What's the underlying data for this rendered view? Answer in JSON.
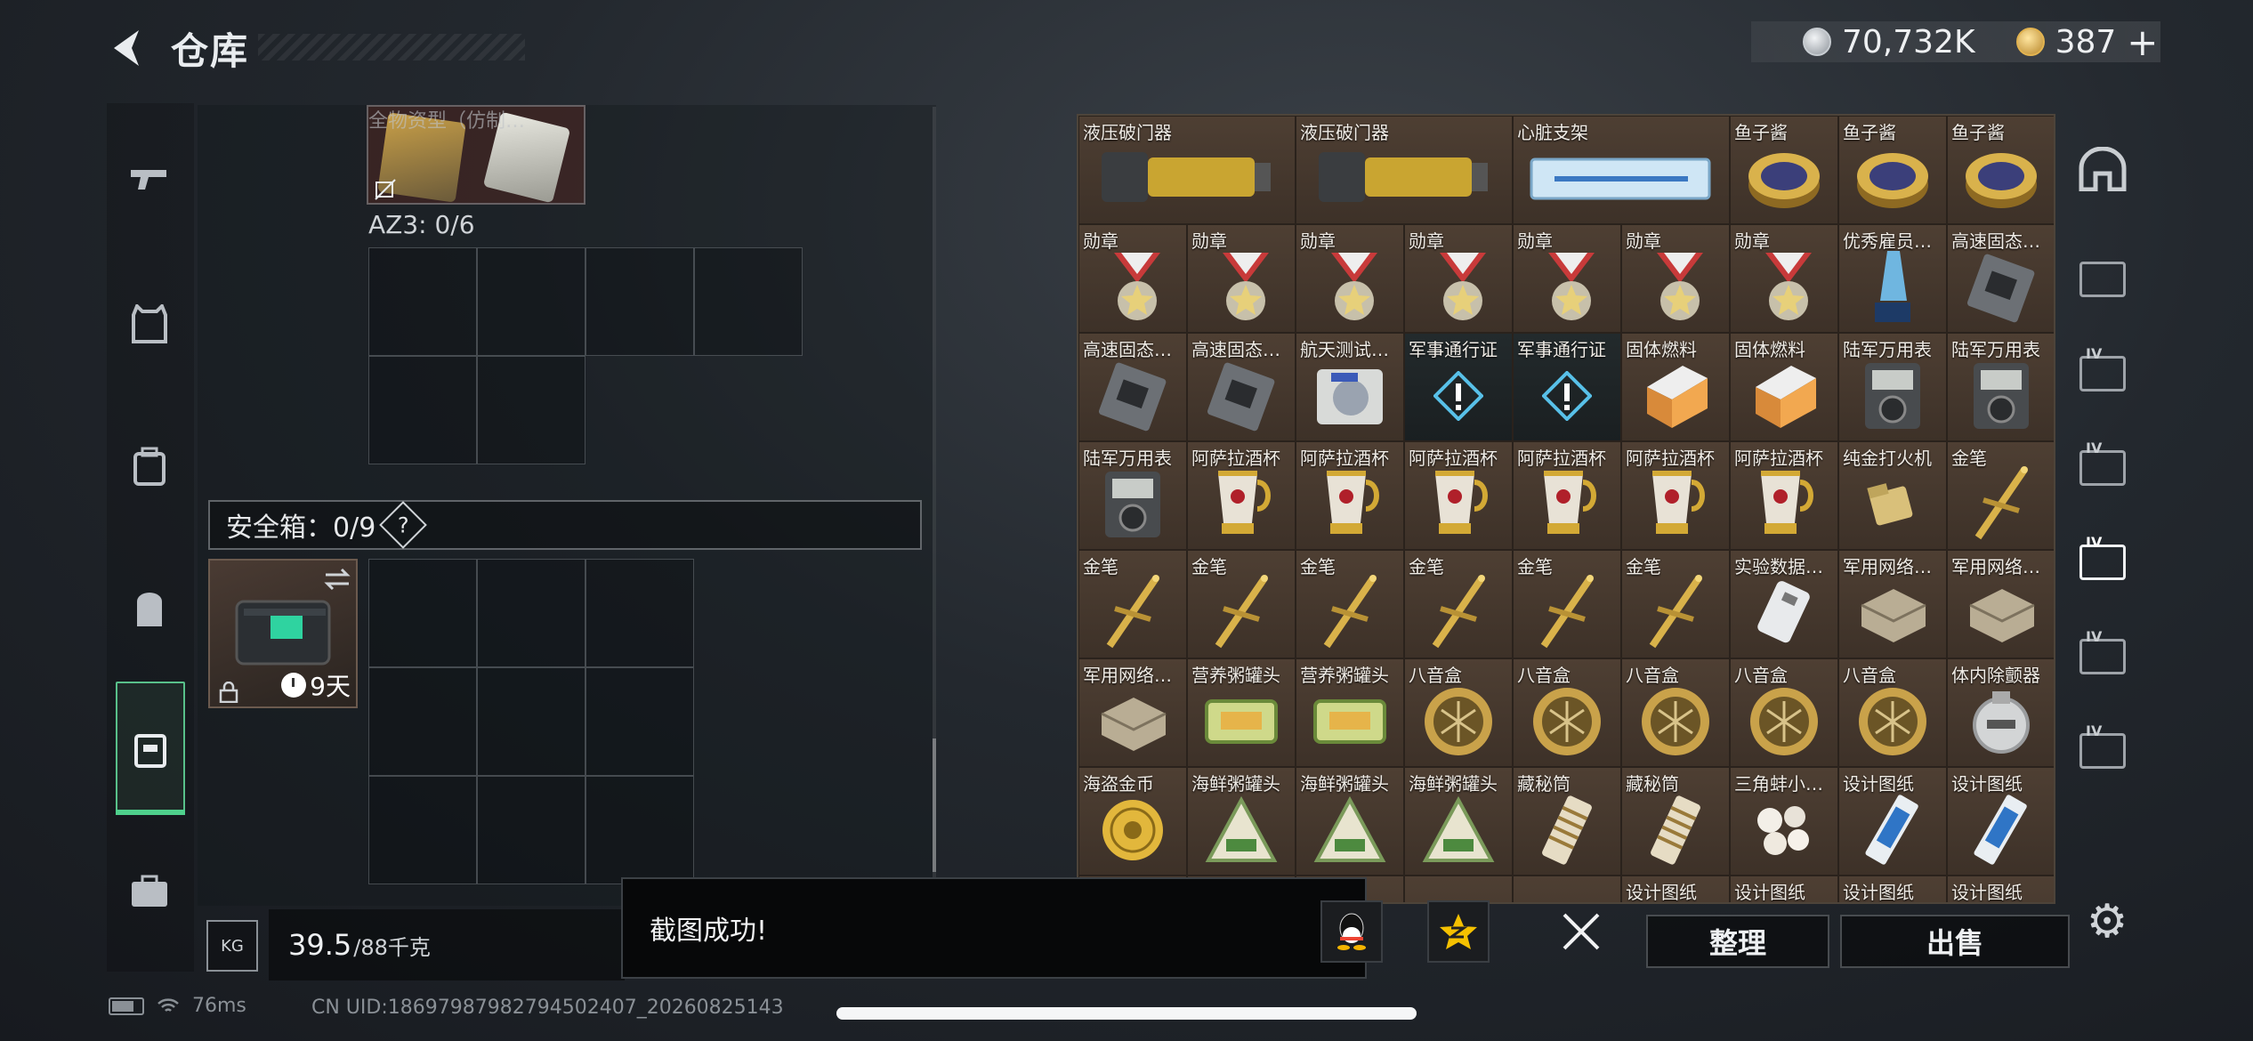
{
  "header": {
    "title": "仓库",
    "currency_silver": "70,732K",
    "currency_gold": "387",
    "add_label": "+"
  },
  "left_nav": [
    "gun-icon",
    "vest-icon",
    "backpack-rig-icon",
    "backpack-icon",
    "safebox-icon",
    "briefcase-icon"
  ],
  "container": {
    "az3_label": "AZ3: 0/6",
    "partial_label": "全物资型（仿制…"
  },
  "safebox": {
    "label": "安全箱：0/9",
    "help": "?",
    "days": "9天"
  },
  "weight": {
    "current": "39.5",
    "max": "/88千克",
    "kg_label": "KG"
  },
  "grid": [
    {
      "name": "液压破门器",
      "w": 2,
      "icon": "breacher"
    },
    {
      "name": "液压破门器",
      "w": 2,
      "icon": "breacher"
    },
    {
      "name": "心脏支架",
      "w": 2,
      "icon": "stent"
    },
    {
      "name": "鱼子酱",
      "w": 1,
      "icon": "caviar"
    },
    {
      "name": "鱼子酱",
      "w": 1,
      "icon": "caviar"
    },
    {
      "name": "鱼子酱",
      "w": 1,
      "icon": "caviar"
    },
    {
      "name": "勋章",
      "w": 1,
      "icon": "medal"
    },
    {
      "name": "勋章",
      "w": 1,
      "icon": "medal"
    },
    {
      "name": "勋章",
      "w": 1,
      "icon": "medal"
    },
    {
      "name": "勋章",
      "w": 1,
      "icon": "medal"
    },
    {
      "name": "勋章",
      "w": 1,
      "icon": "medal"
    },
    {
      "name": "勋章",
      "w": 1,
      "icon": "medal"
    },
    {
      "name": "勋章",
      "w": 1,
      "icon": "medal"
    },
    {
      "name": "优秀雇员…",
      "w": 1,
      "icon": "trophy"
    },
    {
      "name": "高速固态…",
      "w": 1,
      "icon": "ssd"
    },
    {
      "name": "高速固态…",
      "w": 1,
      "icon": "ssd"
    },
    {
      "name": "高速固态…",
      "w": 1,
      "icon": "ssd"
    },
    {
      "name": "航天测试…",
      "w": 1,
      "icon": "device"
    },
    {
      "name": "军事通行证",
      "w": 1,
      "icon": "pass",
      "dark": true
    },
    {
      "name": "军事通行证",
      "w": 1,
      "icon": "pass",
      "dark": true
    },
    {
      "name": "固体燃料",
      "w": 1,
      "icon": "fuel"
    },
    {
      "name": "固体燃料",
      "w": 1,
      "icon": "fuel"
    },
    {
      "name": "陆军万用表",
      "w": 1,
      "icon": "meter"
    },
    {
      "name": "陆军万用表",
      "w": 1,
      "icon": "meter"
    },
    {
      "name": "陆军万用表",
      "w": 1,
      "icon": "meter"
    },
    {
      "name": "阿萨拉酒杯",
      "w": 1,
      "icon": "cup"
    },
    {
      "name": "阿萨拉酒杯",
      "w": 1,
      "icon": "cup"
    },
    {
      "name": "阿萨拉酒杯",
      "w": 1,
      "icon": "cup"
    },
    {
      "name": "阿萨拉酒杯",
      "w": 1,
      "icon": "cup"
    },
    {
      "name": "阿萨拉酒杯",
      "w": 1,
      "icon": "cup"
    },
    {
      "name": "阿萨拉酒杯",
      "w": 1,
      "icon": "cup"
    },
    {
      "name": "纯金打火机",
      "w": 1,
      "icon": "lighter"
    },
    {
      "name": "金笔",
      "w": 1,
      "icon": "pen"
    },
    {
      "name": "金笔",
      "w": 1,
      "icon": "pen"
    },
    {
      "name": "金笔",
      "w": 1,
      "icon": "pen"
    },
    {
      "name": "金笔",
      "w": 1,
      "icon": "pen"
    },
    {
      "name": "金笔",
      "w": 1,
      "icon": "pen"
    },
    {
      "name": "金笔",
      "w": 1,
      "icon": "pen"
    },
    {
      "name": "金笔",
      "w": 1,
      "icon": "pen"
    },
    {
      "name": "实验数据…",
      "w": 1,
      "icon": "drive"
    },
    {
      "name": "军用网络…",
      "w": 1,
      "icon": "router"
    },
    {
      "name": "军用网络…",
      "w": 1,
      "icon": "router"
    },
    {
      "name": "军用网络…",
      "w": 1,
      "icon": "router"
    },
    {
      "name": "营养粥罐头",
      "w": 1,
      "icon": "tin"
    },
    {
      "name": "营养粥罐头",
      "w": 1,
      "icon": "tin"
    },
    {
      "name": "八音盒",
      "w": 1,
      "icon": "musicbox"
    },
    {
      "name": "八音盒",
      "w": 1,
      "icon": "musicbox"
    },
    {
      "name": "八音盒",
      "w": 1,
      "icon": "musicbox"
    },
    {
      "name": "八音盒",
      "w": 1,
      "icon": "musicbox"
    },
    {
      "name": "八音盒",
      "w": 1,
      "icon": "musicbox"
    },
    {
      "name": "体内除颤器",
      "w": 1,
      "icon": "defib"
    },
    {
      "name": "海盗金币",
      "w": 1,
      "icon": "coin"
    },
    {
      "name": "海鲜粥罐头",
      "w": 1,
      "icon": "seafood"
    },
    {
      "name": "海鲜粥罐头",
      "w": 1,
      "icon": "seafood"
    },
    {
      "name": "海鲜粥罐头",
      "w": 1,
      "icon": "seafood"
    },
    {
      "name": "藏秘筒",
      "w": 1,
      "icon": "cryptex"
    },
    {
      "name": "藏秘筒",
      "w": 1,
      "icon": "cryptex"
    },
    {
      "name": "三角蚌小…",
      "w": 1,
      "icon": "pearl"
    },
    {
      "name": "设计图纸",
      "w": 1,
      "icon": "blueprint"
    },
    {
      "name": "设计图纸",
      "w": 1,
      "icon": "blueprint"
    },
    {
      "name": "",
      "w": 1,
      "icon": ""
    },
    {
      "name": "",
      "w": 1,
      "icon": ""
    },
    {
      "name": "",
      "w": 1,
      "icon": ""
    },
    {
      "name": "",
      "w": 1,
      "icon": ""
    },
    {
      "name": "",
      "w": 1,
      "icon": ""
    },
    {
      "name": "设计图纸",
      "w": 1,
      "icon": ""
    },
    {
      "name": "设计图纸",
      "w": 1,
      "icon": ""
    },
    {
      "name": "设计图纸",
      "w": 1,
      "icon": ""
    },
    {
      "name": "设计图纸",
      "w": 1,
      "icon": ""
    }
  ],
  "right_nav": [
    {
      "icon": "helmet-icon",
      "level": ""
    },
    {
      "icon": "filter-1-icon",
      "level": ""
    },
    {
      "icon": "category-iv-icon",
      "level": "IV"
    },
    {
      "icon": "category-iv-add-icon",
      "level": "IV"
    },
    {
      "icon": "category-iv-selected-icon",
      "level": "IV",
      "selected": true
    },
    {
      "icon": "category-iv-b-icon",
      "level": "IV"
    },
    {
      "icon": "category-iv-c-icon",
      "level": "IV"
    }
  ],
  "buttons": {
    "sort": "整理",
    "sell": "出售"
  },
  "toast": {
    "message": "截图成功!",
    "share_qq": "qq-icon",
    "share_qzone": "qzone-icon"
  },
  "status": {
    "ping": "76ms",
    "uid": "CN UID:18697987982794502407_20260825143"
  },
  "colors": {
    "accent_green": "#4fd08c",
    "item_bg": "#4e3f33"
  }
}
